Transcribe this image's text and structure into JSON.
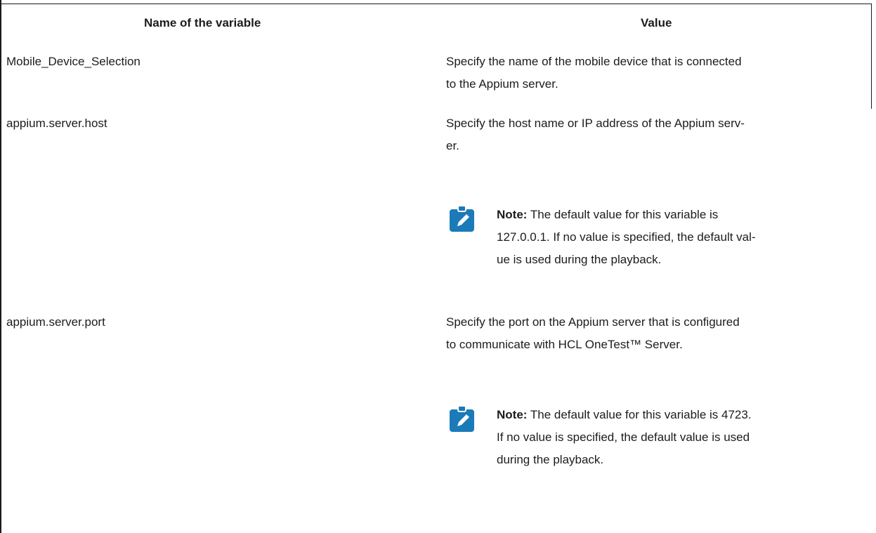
{
  "table": {
    "headers": {
      "name": "Name of the variable",
      "value": "Value"
    },
    "rows": [
      {
        "name": "Mobile_Device_Selection",
        "value_lines": [
          "Specify the name of the mobile device that is connected",
          "to the Appium server."
        ]
      },
      {
        "name": "appium.server.host",
        "value_lines": [
          "Specify the host name or IP address of the Appium serv-",
          "er."
        ],
        "note": {
          "label": "Note:",
          "first_line": "The default value for this variable is",
          "lines": [
            "127.0.0.1. If no value is specified, the default val-",
            "ue is used during the playback."
          ]
        }
      },
      {
        "name": "appium.server.port",
        "value_lines": [
          "Specify the port on the Appium server that is configured",
          "to communicate with HCL OneTest™ Server."
        ],
        "note": {
          "label": "Note:",
          "first_line": "The default value for this variable is 4723.",
          "lines": [
            "If no value is specified, the default value is used",
            "during the playback."
          ]
        }
      }
    ]
  },
  "icons": {
    "note_icon": "pencil-note-icon",
    "note_icon_color": "#1b7ab8"
  }
}
